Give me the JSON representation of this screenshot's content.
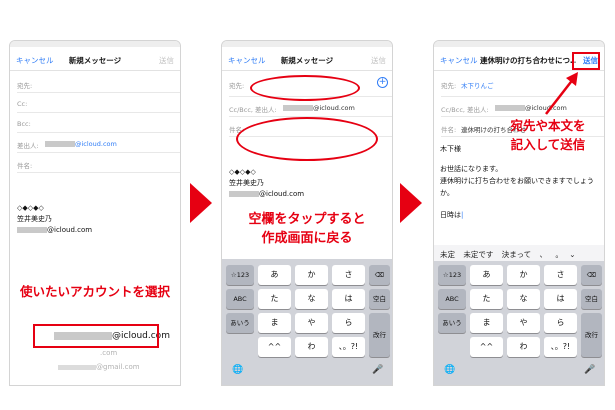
{
  "compose": {
    "cancel": "キャンセル",
    "title": "新規メッセージ",
    "send": "送信"
  },
  "fields": {
    "to": "宛先:",
    "cc": "Cc:",
    "bcc": "Bcc:",
    "from": "差出人:",
    "subject": "件名:",
    "cc_bcc_from": "Cc/Bcc, 差出人:"
  },
  "account": {
    "domain": "@icloud.com",
    "gmail": "@gmail.com",
    "option_dim": ".com"
  },
  "signature": {
    "symbols": "◇◆◇◆◇",
    "name": "笠井美史乃"
  },
  "screen3": {
    "title": "連休明けの打ち合わせにつ…",
    "to_value": "木下りんご",
    "subject_value": "連休明けの打ち合わせ",
    "body": [
      "木下様",
      "お世話になります。",
      "連休明けに打ち合わせをお願いできますでしょうか。",
      "日時は"
    ]
  },
  "candidates": [
    "未定",
    "未定です",
    "決まって",
    "、",
    "。"
  ],
  "keyboard": {
    "row1": [
      "☆123",
      "あ",
      "か",
      "さ",
      "⌫"
    ],
    "row2": [
      "ABC",
      "た",
      "な",
      "は",
      "空白"
    ],
    "row3": [
      "あいう",
      "ま",
      "や",
      "ら",
      "改行"
    ],
    "row4": [
      "^^",
      "わ",
      "、。?!"
    ],
    "globe": "🌐",
    "mic": "🎤"
  },
  "callouts": {
    "select_account": "使いたいアカウントを選択",
    "tap_blank": [
      "空欄をタップすると",
      "作成画面に戻る"
    ],
    "enter_send": [
      "宛先や本文を",
      "記入して送信"
    ]
  },
  "colors": {
    "accent": "#e60012",
    "link": "#2f7cf6"
  }
}
